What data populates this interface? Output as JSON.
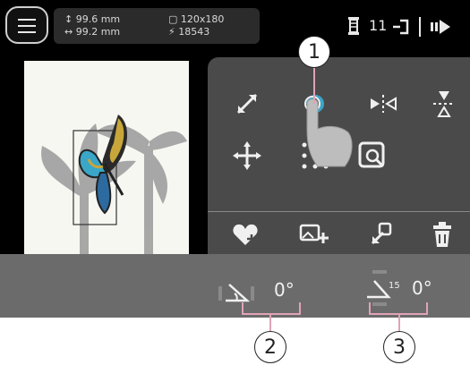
{
  "status_bar": {
    "dim_height": "99.6 mm",
    "dim_width": "99.2 mm",
    "hoop_size": "120x180",
    "stitch_count": "18543",
    "thread_count": "11"
  },
  "edit_tools": {
    "row1": [
      "resize-icon",
      "rotate-icon",
      "mirror-horizontal-icon",
      "mirror-vertical-icon"
    ],
    "row2": [
      "move-icon",
      "grid-icon",
      "check-size-icon"
    ]
  },
  "action_tools": [
    "favorite-add-icon",
    "add-image-icon",
    "pin-icon",
    "delete-icon"
  ],
  "angles": {
    "rotation_value": "0°",
    "slant_value": "0°"
  },
  "callouts": {
    "c1": "1",
    "c2": "2",
    "c3": "3"
  },
  "colors": {
    "panel": "#4a4a4a",
    "accent_blue": "#3aa6c8",
    "callout_line": "#e0a3b5"
  }
}
